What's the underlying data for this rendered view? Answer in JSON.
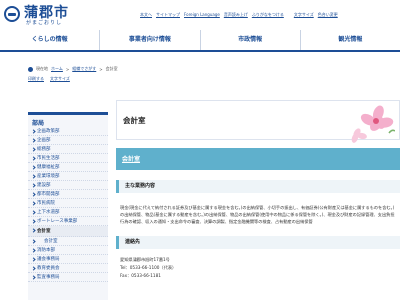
{
  "header": {
    "logo_text": "蒲郡市",
    "logo_kana": "がまごおりし",
    "util_links": [
      "本文へ",
      "サイトマップ",
      "Foreign Language",
      "音声読み上げ",
      "ふりがなをつける",
      "文字サイズ",
      "色合い変更"
    ]
  },
  "gnav": [
    "くらしの情報",
    "事業者向け情報",
    "市政情報",
    "観光情報"
  ],
  "breadcrumb": {
    "home": "現在地",
    "items": [
      "ホーム",
      "組織でさがす",
      "会計室"
    ]
  },
  "aids": [
    "印刷する",
    "文字サイズ"
  ],
  "sidebar": {
    "title": "部局",
    "items": [
      {
        "label": "企画政策部",
        "type": "normal"
      },
      {
        "label": "企画部",
        "type": "normal"
      },
      {
        "label": "総務部",
        "type": "normal"
      },
      {
        "label": "市民生活部",
        "type": "normal"
      },
      {
        "label": "健康福祉部",
        "type": "normal"
      },
      {
        "label": "産業環境部",
        "type": "normal"
      },
      {
        "label": "建設部",
        "type": "normal"
      },
      {
        "label": "都市開発部",
        "type": "normal"
      },
      {
        "label": "市民病院",
        "type": "normal"
      },
      {
        "label": "上下水道部",
        "type": "normal"
      },
      {
        "label": "ボートレース事業部",
        "type": "normal"
      },
      {
        "label": "会計室",
        "type": "active"
      },
      {
        "label": "会計室",
        "type": "sub"
      },
      {
        "label": "消防本部",
        "type": "normal"
      },
      {
        "label": "議会事務局",
        "type": "normal"
      },
      {
        "label": "教育委員会",
        "type": "normal"
      },
      {
        "label": "監査事務局",
        "type": "normal"
      }
    ]
  },
  "main": {
    "page_title": "会計室",
    "section_title": "会計室",
    "duties_heading": "主な業務内容",
    "duties_text": "現金(現金に代えて納付される証券及び基金に属する現金を含む。)の出納保管、小切手の振出し、有価証券(公有財産又は基金に属するものを含む。)の出納保管、物品(基金に属する動産を含む。)の出納保管、物品の出納保管(使用中の物品に係る保管を除く。)、現金及び財産の記録管理、支出負担行為の確認、収入の通知・支出命令の審査、決算の調製、指定金融機関等の検査、占有動産の出納保管",
    "contact_heading": "連絡先",
    "contact_lines": [
      "愛知県蒲郡市旭町17番1号",
      "Tel：0533-66-1100（代表）",
      "Fax：0533-66-1181"
    ]
  }
}
